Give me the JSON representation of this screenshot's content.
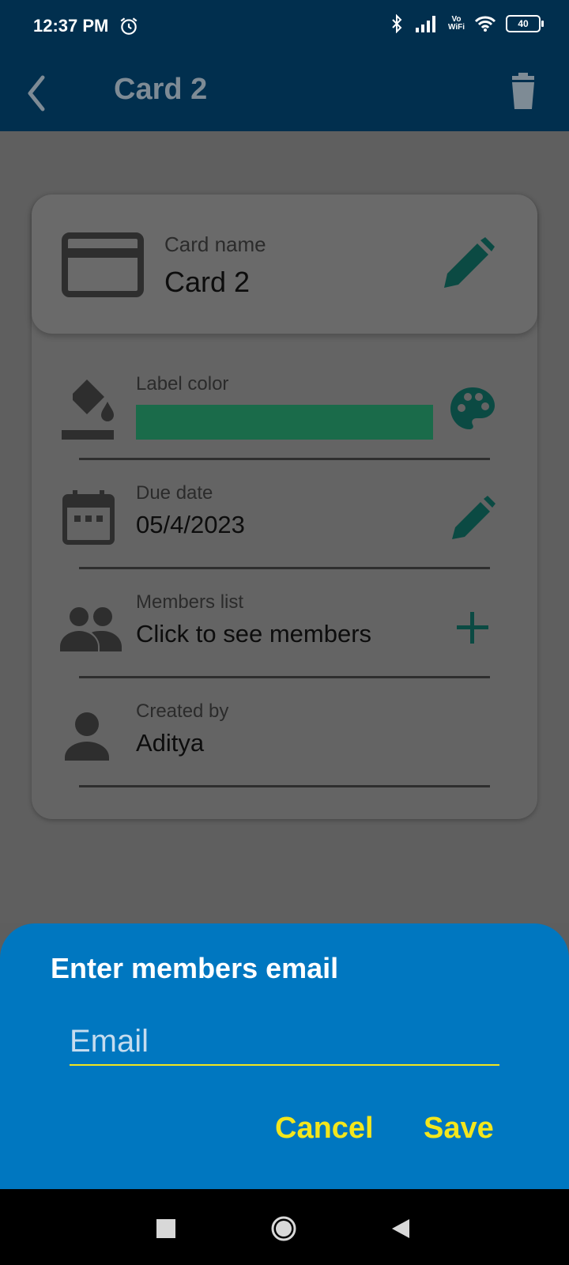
{
  "status_bar": {
    "time": "12:37 PM",
    "vowifi_top": "Vo",
    "vowifi_bottom": "WiFi",
    "battery": "40"
  },
  "app_bar": {
    "title": "Card 2"
  },
  "card_name": {
    "label": "Card name",
    "value": "Card 2"
  },
  "label_color": {
    "label": "Label color",
    "color": "#1a6b4a"
  },
  "due_date": {
    "label": "Due date",
    "value": "05/4/2023"
  },
  "members_list": {
    "label": "Members list",
    "value": "Click to see members"
  },
  "created_by": {
    "label": "Created by",
    "value": "Aditya"
  },
  "dialog": {
    "title": "Enter members email",
    "email_placeholder": "Email",
    "cancel_label": "Cancel",
    "save_label": "Save"
  },
  "colors": {
    "app_bar": "#012f4e",
    "dialog": "#0077c0",
    "accent_yellow": "#f3e61c",
    "icon_teal": "#0b4a43"
  }
}
